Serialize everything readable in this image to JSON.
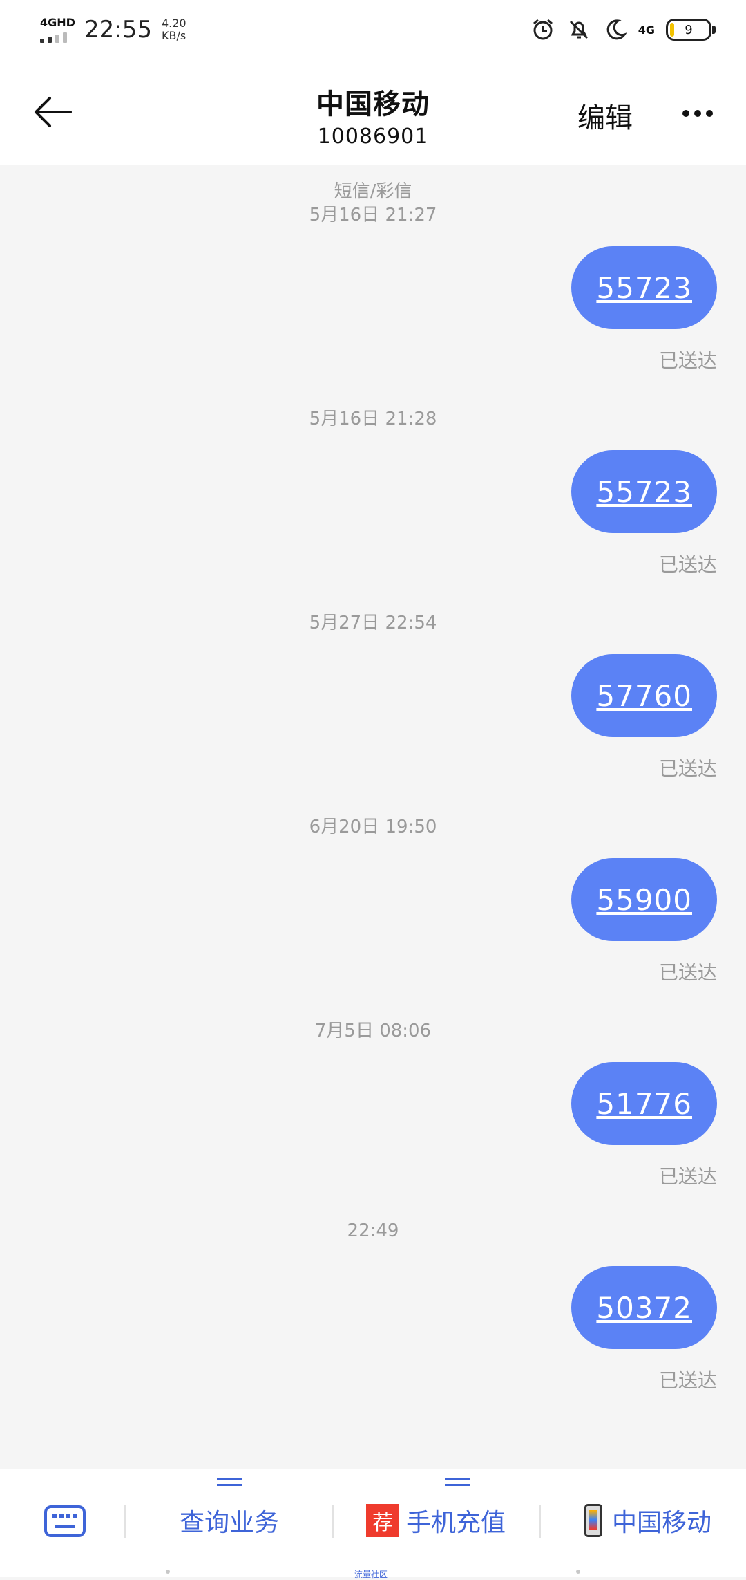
{
  "status_bar": {
    "network": "4GHD",
    "time": "22:55",
    "speed_value": "4.20",
    "speed_unit": "KB/s",
    "network_right": "4G",
    "battery": "9"
  },
  "header": {
    "title": "中国移动",
    "subtitle": "10086901",
    "edit_label": "编辑"
  },
  "thread": {
    "sms_type": "短信/彩信",
    "messages": [
      {
        "time": "5月16日 21:27",
        "text": "55723",
        "status": "已送达"
      },
      {
        "time": "5月16日 21:28",
        "text": "55723",
        "status": "已送达"
      },
      {
        "time": "5月27日 22:54",
        "text": "57760",
        "status": "已送达"
      },
      {
        "time": "6月20日 19:50",
        "text": "55900",
        "status": "已送达"
      },
      {
        "time": "7月5日 08:06",
        "text": "51776",
        "status": "已送达"
      },
      {
        "time": "22:49",
        "text": "50372",
        "status": "已送达"
      }
    ]
  },
  "bottom_menu": {
    "items": [
      {
        "label": "查询业务"
      },
      {
        "label": "手机充值",
        "badge": "荐"
      },
      {
        "label": "中国移动"
      }
    ],
    "tiny_label": "流量社区"
  },
  "colors": {
    "bubble": "#5b82f5",
    "menu_text": "#3e64d8",
    "badge": "#ef3b2d"
  }
}
